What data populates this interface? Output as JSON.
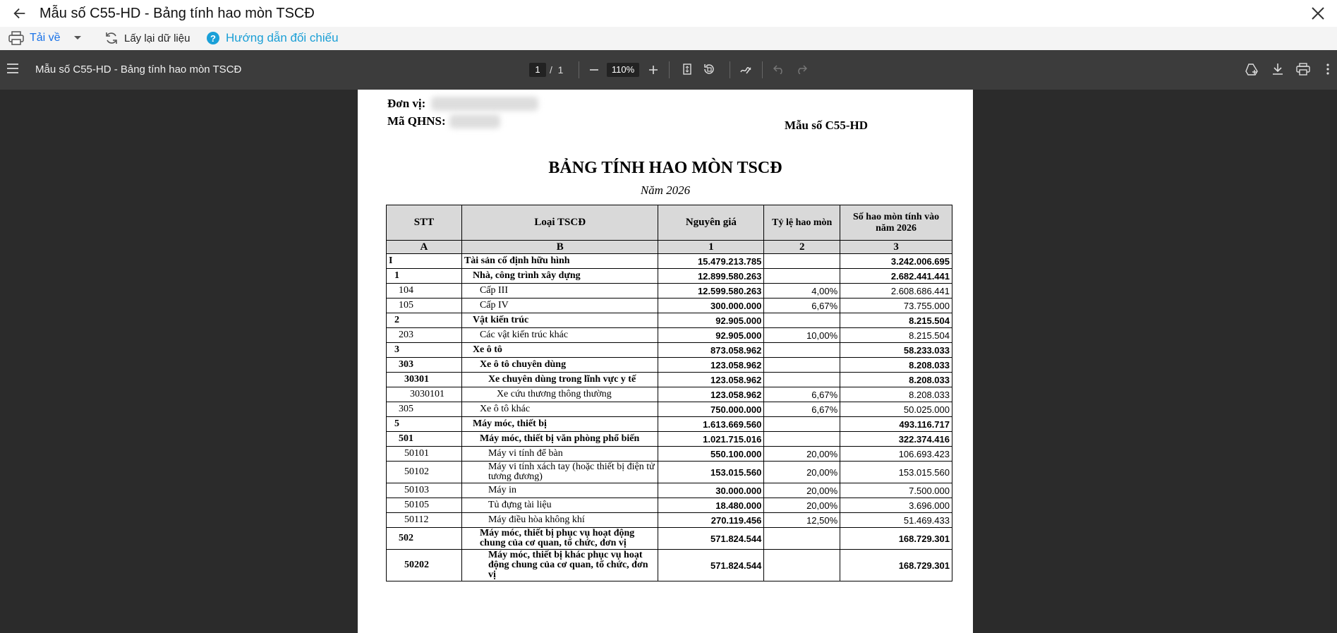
{
  "window": {
    "title": "Mẫu số C55-HD - Bảng tính hao mòn TSCĐ"
  },
  "toolbar": {
    "download_label": "Tải về",
    "reload_label": "Lấy lại dữ liệu",
    "guide_label": "Hướng dẫn đối chiếu"
  },
  "pdf": {
    "file_title": "Mẫu số C55-HD - Bảng tính hao mòn TSCĐ",
    "current_page": "1",
    "page_sep": "/",
    "total_pages": "1",
    "zoom": "110%"
  },
  "document": {
    "unit_label": "Đơn vị:",
    "qhns_label": "Mã QHNS:",
    "form_code": "Mẫu số C55-HD",
    "title": "BẢNG TÍNH HAO MÒN TSCĐ",
    "year": "Năm 2026",
    "headers": [
      "STT",
      "Loại TSCĐ",
      "Nguyên giá",
      "Tỷ lệ hao mòn",
      "Số hao mòn tính vào năm 2026"
    ],
    "subheaders": [
      "A",
      "B",
      "1",
      "2",
      "3"
    ],
    "rows": [
      {
        "stt": "I",
        "name": "Tài sản cố định hữu hình",
        "cost": "15.479.213.785",
        "rate": "",
        "dep": "3.242.006.695",
        "bold": true,
        "lvl": 0
      },
      {
        "stt": "1",
        "name": "Nhà, công trình xây dựng",
        "cost": "12.899.580.263",
        "rate": "",
        "dep": "2.682.441.441",
        "bold": true,
        "lvl": 1
      },
      {
        "stt": "104",
        "name": "Cấp III",
        "cost": "12.599.580.263",
        "rate": "4,00%",
        "dep": "2.608.686.441",
        "bold": false,
        "lvl": 2
      },
      {
        "stt": "105",
        "name": "Cấp IV",
        "cost": "300.000.000",
        "rate": "6,67%",
        "dep": "73.755.000",
        "bold": false,
        "lvl": 2
      },
      {
        "stt": "2",
        "name": "Vật kiến trúc",
        "cost": "92.905.000",
        "rate": "",
        "dep": "8.215.504",
        "bold": true,
        "lvl": 1
      },
      {
        "stt": "203",
        "name": "Các vật kiến trúc khác",
        "cost": "92.905.000",
        "rate": "10,00%",
        "dep": "8.215.504",
        "bold": false,
        "lvl": 2
      },
      {
        "stt": "3",
        "name": "Xe ô tô",
        "cost": "873.058.962",
        "rate": "",
        "dep": "58.233.033",
        "bold": true,
        "lvl": 1
      },
      {
        "stt": "303",
        "name": "Xe ô tô chuyên dùng",
        "cost": "123.058.962",
        "rate": "",
        "dep": "8.208.033",
        "bold": true,
        "lvl": 2
      },
      {
        "stt": "30301",
        "name": "Xe chuyên dùng trong lĩnh vực y tế",
        "cost": "123.058.962",
        "rate": "",
        "dep": "8.208.033",
        "bold": true,
        "lvl": 3
      },
      {
        "stt": "3030101",
        "name": "Xe cứu thương thông thường",
        "cost": "123.058.962",
        "rate": "6,67%",
        "dep": "8.208.033",
        "bold": false,
        "lvl": 4
      },
      {
        "stt": "305",
        "name": "Xe ô tô khác",
        "cost": "750.000.000",
        "rate": "6,67%",
        "dep": "50.025.000",
        "bold": false,
        "lvl": 2
      },
      {
        "stt": "5",
        "name": "Máy móc, thiết bị",
        "cost": "1.613.669.560",
        "rate": "",
        "dep": "493.116.717",
        "bold": true,
        "lvl": 1
      },
      {
        "stt": "501",
        "name": "Máy móc, thiết bị văn phòng phổ biến",
        "cost": "1.021.715.016",
        "rate": "",
        "dep": "322.374.416",
        "bold": true,
        "lvl": 2
      },
      {
        "stt": "50101",
        "name": "Máy vi tính để bàn",
        "cost": "550.100.000",
        "rate": "20,00%",
        "dep": "106.693.423",
        "bold": false,
        "lvl": 3
      },
      {
        "stt": "50102",
        "name": "Máy vi tính xách tay (hoặc thiết bị điện tử tương đương)",
        "cost": "153.015.560",
        "rate": "20,00%",
        "dep": "153.015.560",
        "bold": false,
        "lvl": 3
      },
      {
        "stt": "50103",
        "name": "Máy in",
        "cost": "30.000.000",
        "rate": "20,00%",
        "dep": "7.500.000",
        "bold": false,
        "lvl": 3
      },
      {
        "stt": "50105",
        "name": "Tủ đựng tài liệu",
        "cost": "18.480.000",
        "rate": "20,00%",
        "dep": "3.696.000",
        "bold": false,
        "lvl": 3
      },
      {
        "stt": "50112",
        "name": "Máy điều hòa không khí",
        "cost": "270.119.456",
        "rate": "12,50%",
        "dep": "51.469.433",
        "bold": false,
        "lvl": 3
      },
      {
        "stt": "502",
        "name": "Máy móc, thiết bị phục vụ hoạt động chung của cơ quan, tổ chức, đơn vị",
        "cost": "571.824.544",
        "rate": "",
        "dep": "168.729.301",
        "bold": true,
        "lvl": 2
      },
      {
        "stt": "50202",
        "name": "Máy móc, thiết bị khác phục vụ hoạt động chung của cơ quan, tổ chức, đơn vị",
        "cost": "571.824.544",
        "rate": "",
        "dep": "168.729.301",
        "bold": true,
        "lvl": 3
      }
    ]
  }
}
